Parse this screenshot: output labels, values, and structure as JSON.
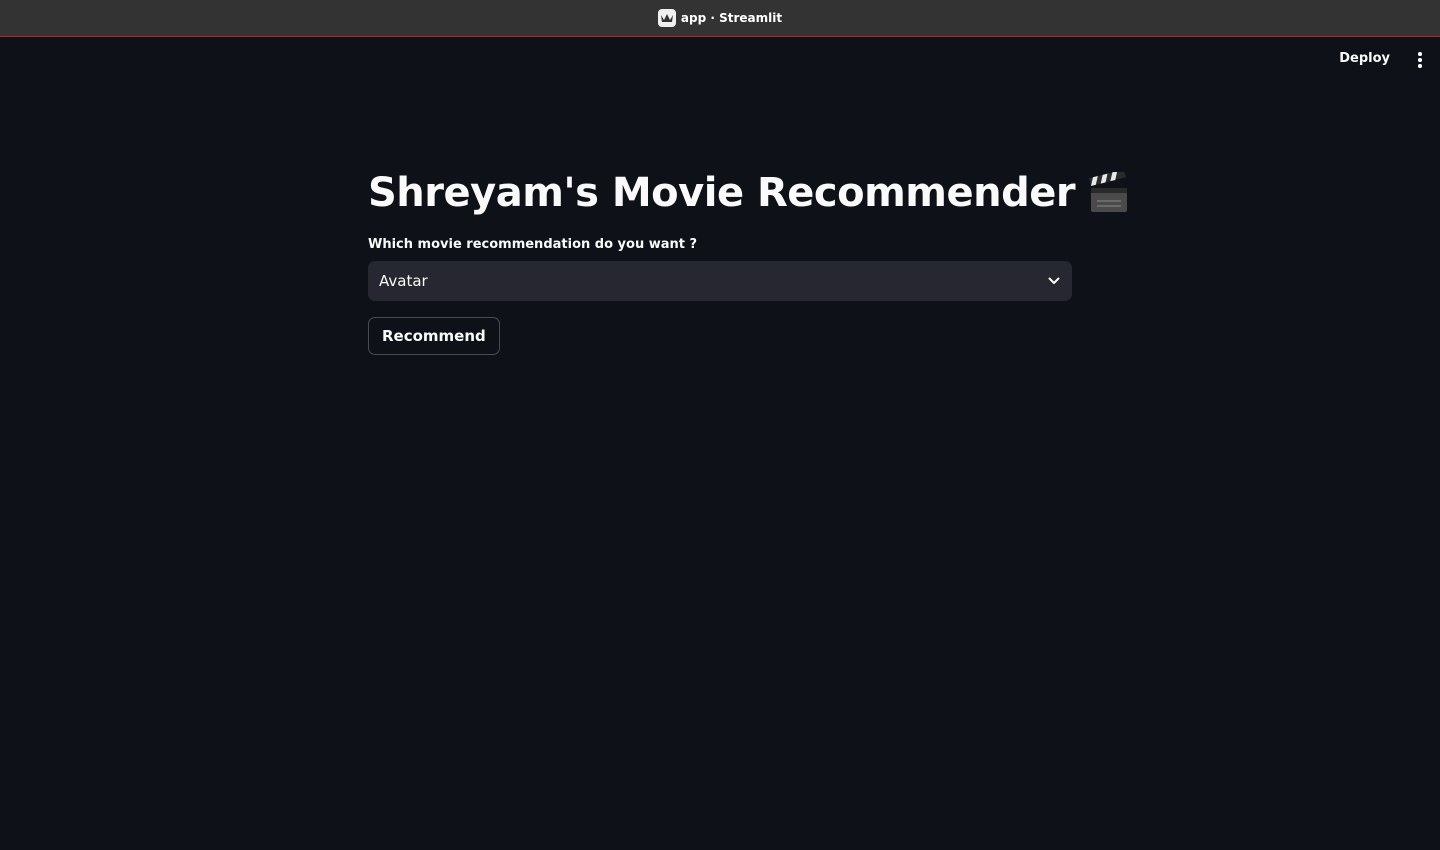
{
  "window": {
    "title": "app · Streamlit",
    "favicon_icon": "streamlit-crown-icon"
  },
  "toolbar": {
    "deploy_label": "Deploy",
    "menu_icon": "kebab-menu-icon"
  },
  "main": {
    "title": "Shreyam's Movie Recommender",
    "title_emoji_icon": "clapper-board-icon",
    "select": {
      "label": "Which movie recommendation do you want ?",
      "selected_value": "Avatar",
      "icon": "chevron-down-icon"
    },
    "recommend_button_label": "Recommend"
  },
  "colors": {
    "background": "#0e1117",
    "titlebar": "#333333",
    "select_background": "#262730",
    "text": "#fafafa"
  }
}
